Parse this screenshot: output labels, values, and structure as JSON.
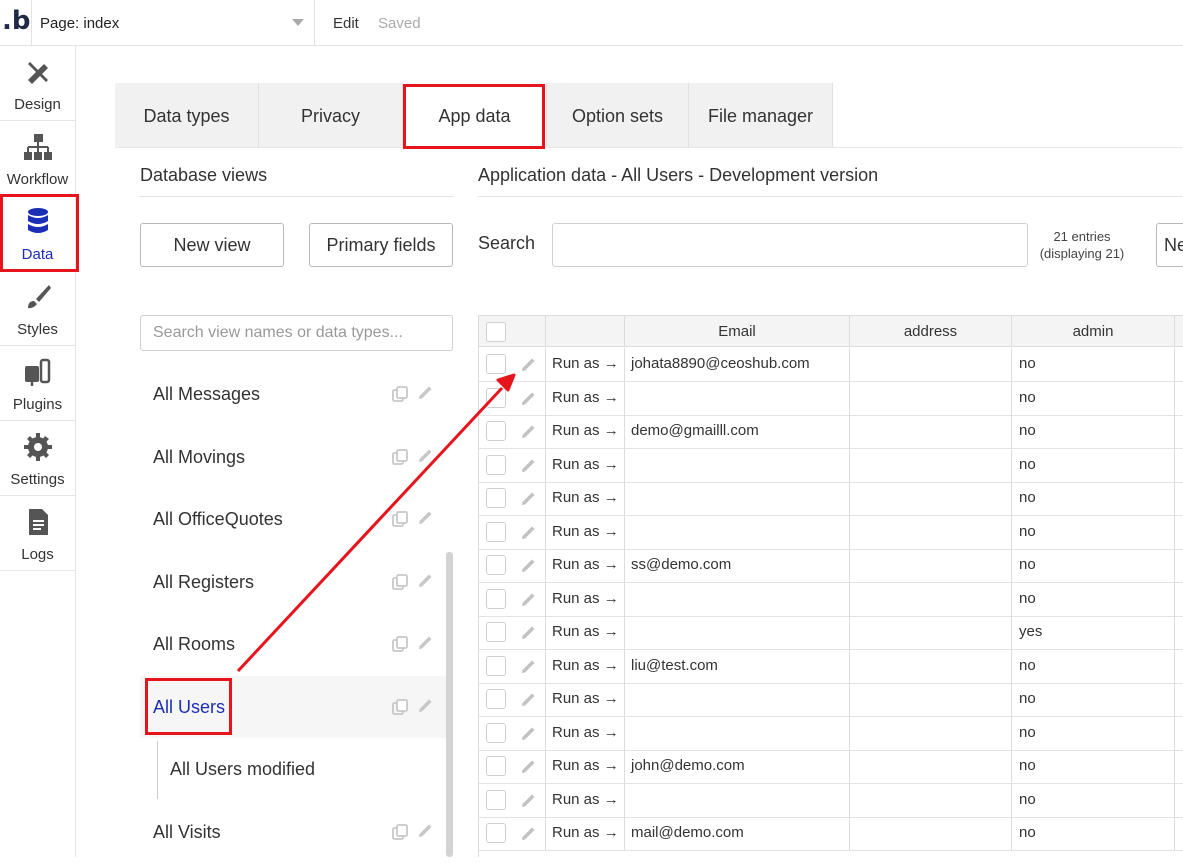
{
  "topbar": {
    "logo": ".b",
    "page_label": "Page: index",
    "edit_label": "Edit",
    "status": "Saved"
  },
  "sidebar": {
    "items": [
      {
        "label": "Design",
        "icon": "design-icon"
      },
      {
        "label": "Workflow",
        "icon": "workflow-icon"
      },
      {
        "label": "Data",
        "icon": "database-icon",
        "active": true
      },
      {
        "label": "Styles",
        "icon": "brush-icon"
      },
      {
        "label": "Plugins",
        "icon": "plug-icon"
      },
      {
        "label": "Settings",
        "icon": "gear-icon"
      },
      {
        "label": "Logs",
        "icon": "document-icon"
      }
    ]
  },
  "tabs": [
    "Data types",
    "Privacy",
    "App data",
    "Option sets",
    "File manager"
  ],
  "active_tab": "App data",
  "left_panel": {
    "title": "Database views",
    "new_view_label": "New view",
    "primary_fields_label": "Primary fields",
    "search_placeholder": "Search view names or data types...",
    "views": [
      "All Messages",
      "All Movings",
      "All OfficeQuotes",
      "All Registers",
      "All Rooms",
      "All Users",
      "All Users modified",
      "All Visits"
    ],
    "selected_view": "All Users"
  },
  "right_panel": {
    "title": "Application data - All Users - Development version",
    "search_label": "Search",
    "entries_line1": "21 entries",
    "entries_line2": "(displaying 21)",
    "new_entry_label": "New entry",
    "columns": [
      "",
      "",
      "Email",
      "address",
      "admin"
    ],
    "run_as_label": "Run as →",
    "rows": [
      {
        "email": "johata8890@ceoshub.com",
        "admin": "no"
      },
      {
        "email": "",
        "admin": "no"
      },
      {
        "email": "demo@gmailll.com",
        "admin": "no"
      },
      {
        "email": "",
        "admin": "no"
      },
      {
        "email": "",
        "admin": "no"
      },
      {
        "email": "",
        "admin": "no"
      },
      {
        "email": "ss@demo.com",
        "admin": "no"
      },
      {
        "email": "",
        "admin": "no"
      },
      {
        "email": "",
        "admin": "yes"
      },
      {
        "email": "liu@test.com",
        "admin": "no"
      },
      {
        "email": "",
        "admin": "no"
      },
      {
        "email": "",
        "admin": "no"
      },
      {
        "email": "john@demo.com",
        "admin": "no"
      },
      {
        "email": "",
        "admin": "no"
      },
      {
        "email": "mail@demo.com",
        "admin": "no"
      }
    ]
  },
  "colors": {
    "accent": "#1a2fb5",
    "highlight": "#e8141b"
  }
}
